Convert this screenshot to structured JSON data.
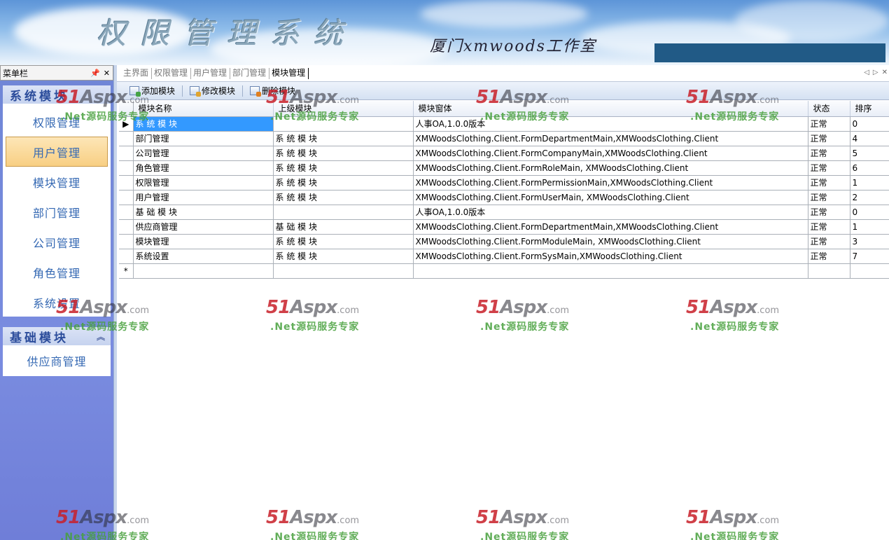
{
  "banner": {
    "title": "权限管理系统",
    "studio": "厦门xmwoods工作室"
  },
  "left_panel": {
    "header": "菜单栏",
    "pin_icon": "pin-icon",
    "close_icon": "close-icon",
    "groups": [
      {
        "title": "系统模块",
        "items": [
          "权限管理",
          "用户管理",
          "模块管理",
          "部门管理",
          "公司管理",
          "角色管理",
          "系统设置"
        ],
        "selected": "用户管理"
      },
      {
        "title": "基础模块",
        "items": [
          "供应商管理"
        ]
      }
    ]
  },
  "tabs": [
    "主界面",
    "权限管理",
    "用户管理",
    "部门管理",
    "模块管理"
  ],
  "active_tab": "模块管理",
  "toolbar": {
    "add": "添加模块",
    "edit": "修改模块",
    "delete": "删除模块"
  },
  "grid": {
    "columns": [
      "模块名称",
      "上级模块",
      "模块窗体",
      "状态",
      "排序"
    ],
    "rows": [
      [
        "系 统 模 块",
        "",
        "人事OA,1.0.0版本",
        "正常",
        "0"
      ],
      [
        "部门管理",
        "系 统 模 块",
        "XMWoodsClothing.Client.FormDepartmentMain,XMWoodsClothing.Client",
        "正常",
        "4"
      ],
      [
        "公司管理",
        "系 统 模 块",
        "XMWoodsClothing.Client.FormCompanyMain,XMWoodsClothing.Client",
        "正常",
        "5"
      ],
      [
        "角色管理",
        "系 统 模 块",
        "XMWoodsClothing.Client.FormRoleMain, XMWoodsClothing.Client",
        "正常",
        "6"
      ],
      [
        "权限管理",
        "系 统 模 块",
        "XMWoodsClothing.Client.FormPermissionMain,XMWoodsClothing.Client",
        "正常",
        "1"
      ],
      [
        "用户管理",
        "系 统 模 块",
        "XMWoodsClothing.Client.FormUserMain, XMWoodsClothing.Client",
        "正常",
        "2"
      ],
      [
        "基 础 模 块",
        "",
        "人事OA,1.0.0版本",
        "正常",
        "0"
      ],
      [
        "供应商管理",
        "基 础 模 块",
        "XMWoodsClothing.Client.FormDepartmentMain,XMWoodsClothing.Client",
        "正常",
        "1"
      ],
      [
        "模块管理",
        "系 统 模 块",
        "XMWoodsClothing.Client.FormModuleMain, XMWoodsClothing.Client",
        "正常",
        "3"
      ],
      [
        "系统设置",
        "系 统 模 块",
        "XMWoodsClothing.Client.FormSysMain,XMWoodsClothing.Client",
        "正常",
        "7"
      ]
    ],
    "current_row_marker": "▶",
    "new_row_marker": "*"
  },
  "watermark": {
    "logo_num": "51",
    "logo_aspx": "Aspx",
    "logo_com": ".com",
    "subtitle": ".Net源码服务专家"
  }
}
